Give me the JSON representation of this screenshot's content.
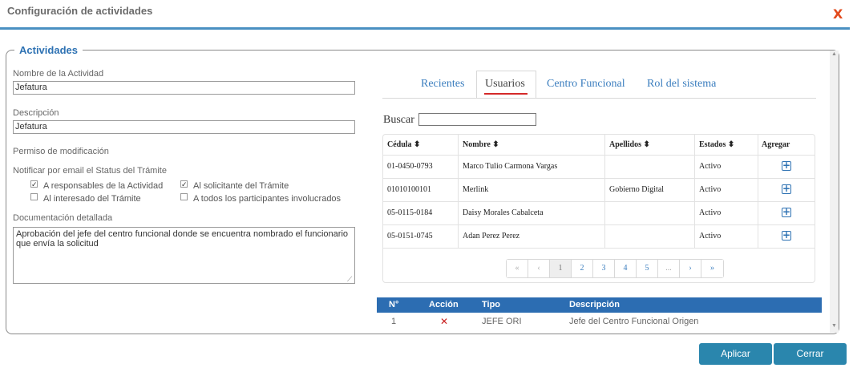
{
  "dialog": {
    "title": "Configuración de actividades",
    "close_label": "X"
  },
  "section": {
    "legend": "Actividades"
  },
  "form": {
    "name_label": "Nombre de la Actividad",
    "name_value": "Jefatura",
    "description_label": "Descripción",
    "description_value": "Jefatura",
    "permission_label": "Permiso de modificación",
    "notify_label": "Notificar por email el Status del Trámite",
    "checkboxes": [
      {
        "label": "A responsables de la Actividad",
        "checked": true
      },
      {
        "label": "Al solicitante del Trámite",
        "checked": true
      },
      {
        "label": "Al interesado del Trámite",
        "checked": false
      },
      {
        "label": "A todos los participantes involucrados",
        "checked": false
      }
    ],
    "doc_label": "Documentación detallada",
    "doc_value": "Aprobación del jefe del centro funcional donde se encuentra nombrado el funcionario que envía la solicitud"
  },
  "tabs": [
    {
      "label": "Recientes",
      "active": false
    },
    {
      "label": "Usuarios",
      "active": true
    },
    {
      "label": "Centro Funcional",
      "active": false
    },
    {
      "label": "Rol del sistema",
      "active": false
    }
  ],
  "search": {
    "label": "Buscar",
    "value": ""
  },
  "users_table": {
    "headers": [
      "Cédula ⬍",
      "Nombre ⬍",
      "Apellidos ⬍",
      "Estados ⬍",
      "Agregar"
    ],
    "rows": [
      [
        "01-0450-0793",
        "Marco Tulio Carmona Vargas",
        "",
        "Activo"
      ],
      [
        "01010100101",
        "Merlink",
        "Gobierno Digital",
        "Activo"
      ],
      [
        "05-0115-0184",
        "Daisy Morales Cabalceta",
        "",
        "Activo"
      ],
      [
        "05-0151-0745",
        "Adan Perez Perez",
        "",
        "Activo"
      ]
    ],
    "add_icon": "plus-square-icon"
  },
  "pagination": [
    "«",
    "‹",
    "1",
    "2",
    "3",
    "4",
    "5",
    "...",
    "›",
    "»"
  ],
  "assigned_table": {
    "headers": [
      "N°",
      "Acción",
      "Tipo",
      "Descripción"
    ],
    "rows": [
      {
        "number": "1",
        "action_icon": "delete-x-icon",
        "type": "JEFE ORI",
        "description": "Jefe del Centro Funcional Origen"
      }
    ]
  },
  "buttons": {
    "apply": "Aplicar",
    "close": "Cerrar"
  },
  "colors": {
    "accent": "#2e72b3",
    "header_line": "#4a90c2",
    "button": "#2a86ad",
    "close_x": "#e24a1c",
    "active_tab_underline": "#d42a2a"
  }
}
